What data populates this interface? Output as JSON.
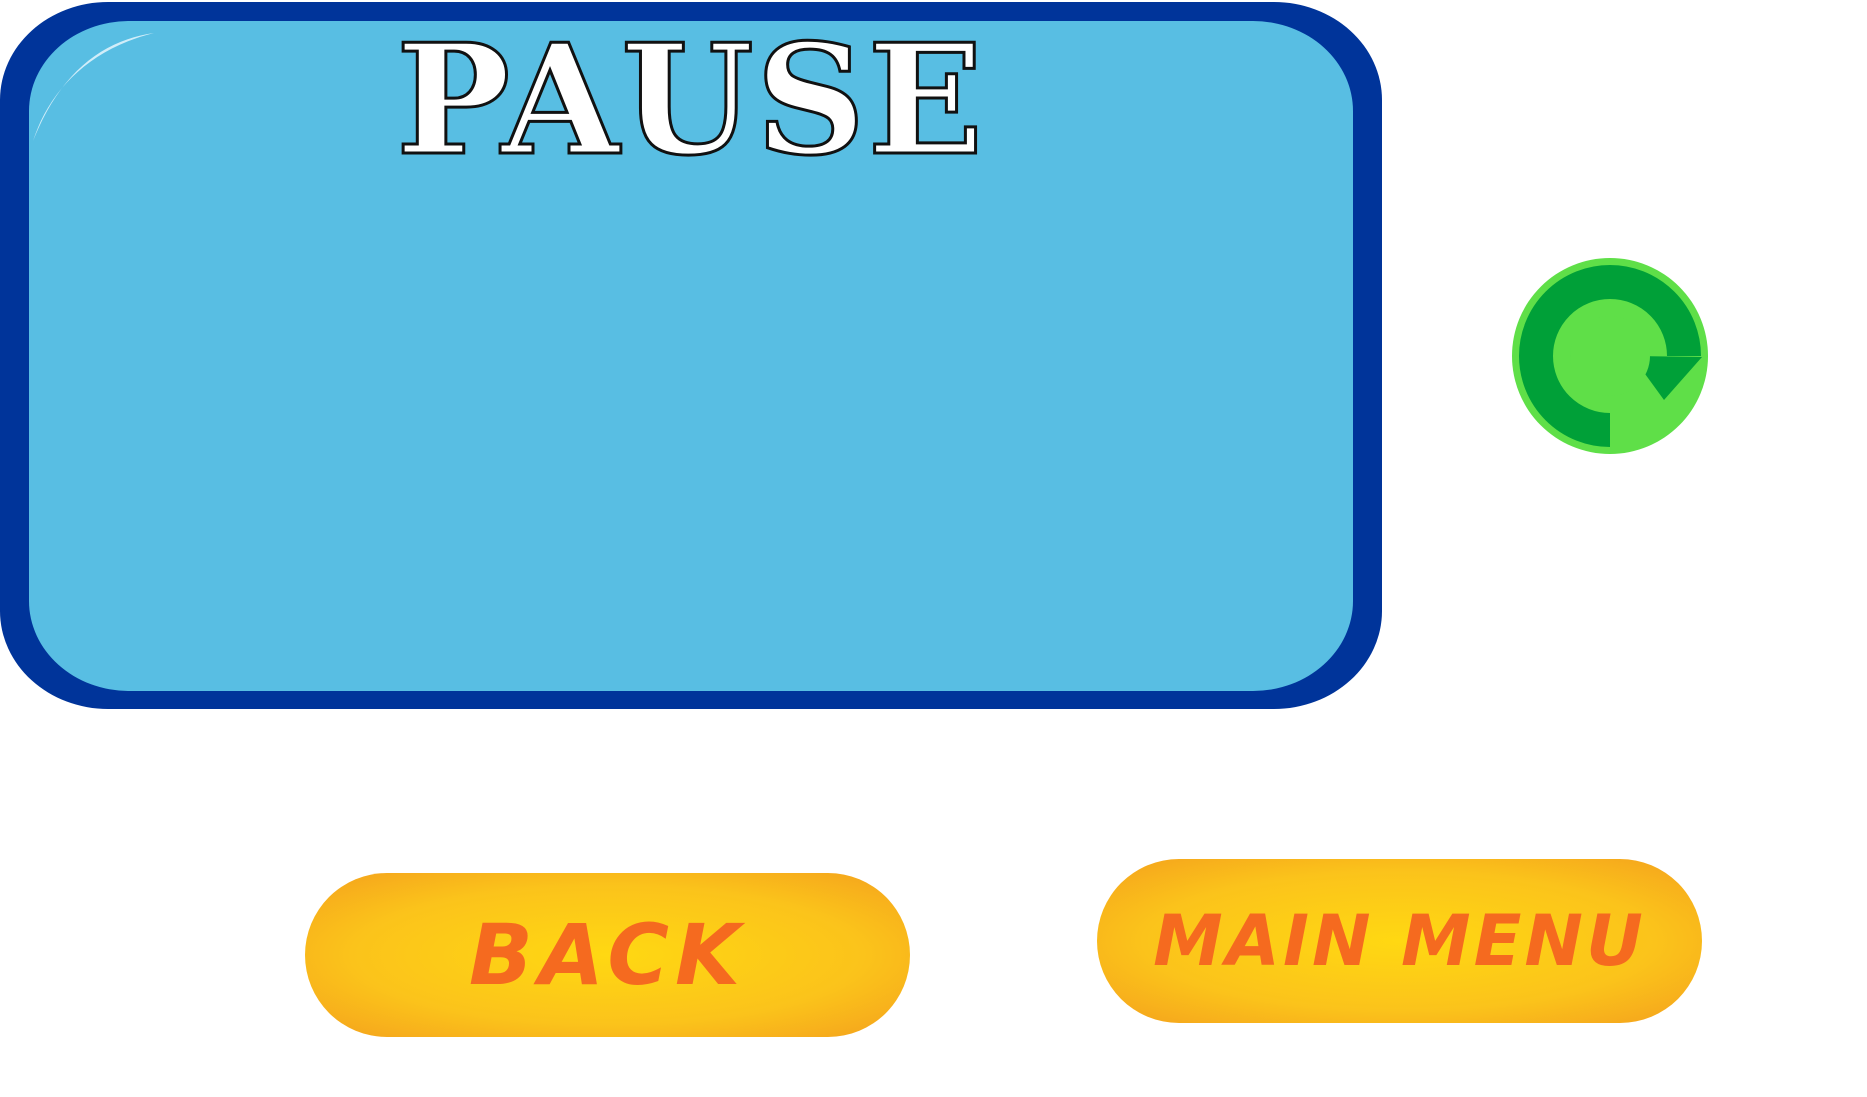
{
  "screen": {
    "title": "PAUSE"
  },
  "buttons": {
    "back_label": "BACK",
    "main_menu_label": "MAIN MENU"
  },
  "icons": {
    "restart": "restart-arrow-icon"
  },
  "colors": {
    "panel_border": "#00349a",
    "panel_fill": "#58bee3",
    "restart_outer": "#5fdf48",
    "restart_arrow": "#00a038",
    "button_fill": "#fbc31b",
    "button_text": "#f56a1f"
  }
}
